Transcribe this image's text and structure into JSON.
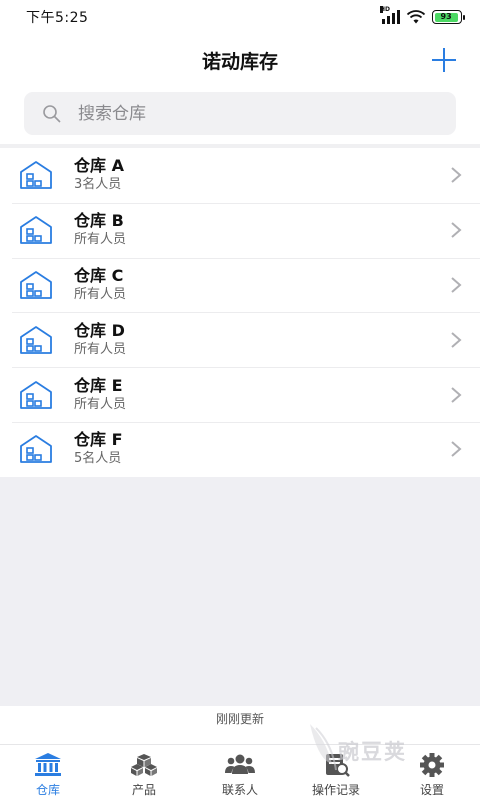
{
  "status_bar": {
    "time": "下午5:25",
    "network": "HD",
    "battery_level": "93"
  },
  "header": {
    "title": "诺动库存"
  },
  "search": {
    "placeholder": "搜索仓库"
  },
  "warehouses": [
    {
      "name": "仓库 A",
      "subtitle": "3名人员"
    },
    {
      "name": "仓库 B",
      "subtitle": "所有人员"
    },
    {
      "name": "仓库 C",
      "subtitle": "所有人员"
    },
    {
      "name": "仓库 D",
      "subtitle": "所有人员"
    },
    {
      "name": "仓库 E",
      "subtitle": "所有人员"
    },
    {
      "name": "仓库 F",
      "subtitle": "5名人员"
    }
  ],
  "refresh_status": "刚刚更新",
  "tabs": [
    {
      "label": "仓库",
      "icon": "bank-icon",
      "active": true
    },
    {
      "label": "产品",
      "icon": "boxes-icon",
      "active": false
    },
    {
      "label": "联系人",
      "icon": "people-icon",
      "active": false
    },
    {
      "label": "操作记录",
      "icon": "records-icon",
      "active": false
    },
    {
      "label": "设置",
      "icon": "gear-icon",
      "active": false
    }
  ],
  "watermark": "豌豆荚",
  "colors": {
    "accent": "#2a7de1",
    "tab_inactive": "#555555",
    "background_gray": "#efeff3"
  }
}
